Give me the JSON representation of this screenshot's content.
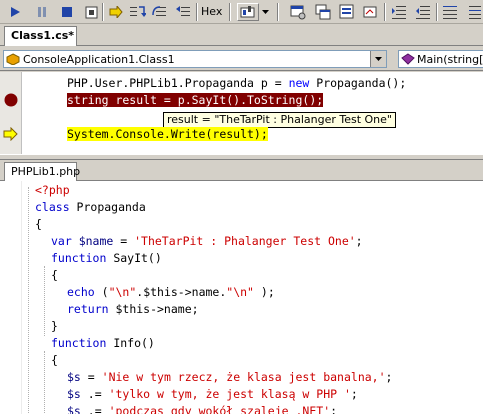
{
  "toolbar": {
    "hex_label": "Hex",
    "icons": [
      "step-into-icon",
      "pause-icon",
      "stop-icon",
      "restart-icon",
      "show-next-statement-icon",
      "step-over-icon",
      "step-out-icon",
      "step-back-icon",
      "hex-toggle",
      "breakpoints-icon",
      "dropdown-arrow-icon",
      "watch-icon",
      "locals-icon",
      "callstack-icon",
      "registers-icon",
      "indent-icon",
      "outdent-icon",
      "align-icon",
      "comment-icon"
    ]
  },
  "document_tabs": {
    "active_tab": "Class1.cs*"
  },
  "member_bar": {
    "class_combo": "ConsoleApplication1.Class1",
    "member_combo": "Main(string[]"
  },
  "upper_pane": {
    "line1": {
      "type": "PHP.User.PHPLib1.Propaganda",
      "var": " p = ",
      "kw": "new",
      "rest": " Propaganda();"
    },
    "line2": "string result = p.SayIt().ToString();",
    "tooltip": "result = \"TheTarPit : Phalanger Test One\"",
    "line3": "System.Console.Write(result);"
  },
  "lower_tab": {
    "label": "PHPLib1.php"
  },
  "lower_pane": {
    "lines": [
      {
        "a": "<?php"
      },
      {
        "kw": "class",
        "rest": " Propaganda"
      },
      {
        "rest": "{"
      },
      {
        "kw": "var",
        "var": " $name",
        "rest": " = ",
        "str": "'TheTarPit : Phalanger Test One'",
        "end": ";"
      },
      {
        "kw": "function",
        "rest": " SayIt()"
      },
      {
        "rest": "{"
      },
      {
        "kw": "echo",
        "rest": " (",
        "str": "\"\\n\"",
        "rest2": ".$this->name.",
        "str2": "\"\\n\"",
        "end": " );"
      },
      {
        "kw": "return",
        "rest": " $this->name;"
      },
      {
        "rest": "}"
      },
      {
        "kw": "function",
        "rest": " Info()"
      },
      {
        "rest": "{"
      },
      {
        "var": "$s",
        "rest": " = ",
        "str": "'Nie w tym rzecz, że klasa jest banalna,'",
        "end": ";"
      },
      {
        "var": "$s",
        "rest": " .= ",
        "str": "'tylko w tym, że jest klasą w PHP '",
        "end": ";"
      },
      {
        "var": "$s",
        "rest": " .= ",
        "str": "'podczas gdy wokół szaleje .NET'",
        "end": ";"
      }
    ]
  },
  "colors": {
    "breakpoint": "#800000",
    "current_line": "#ffff00",
    "keyword": "#0000ff"
  }
}
